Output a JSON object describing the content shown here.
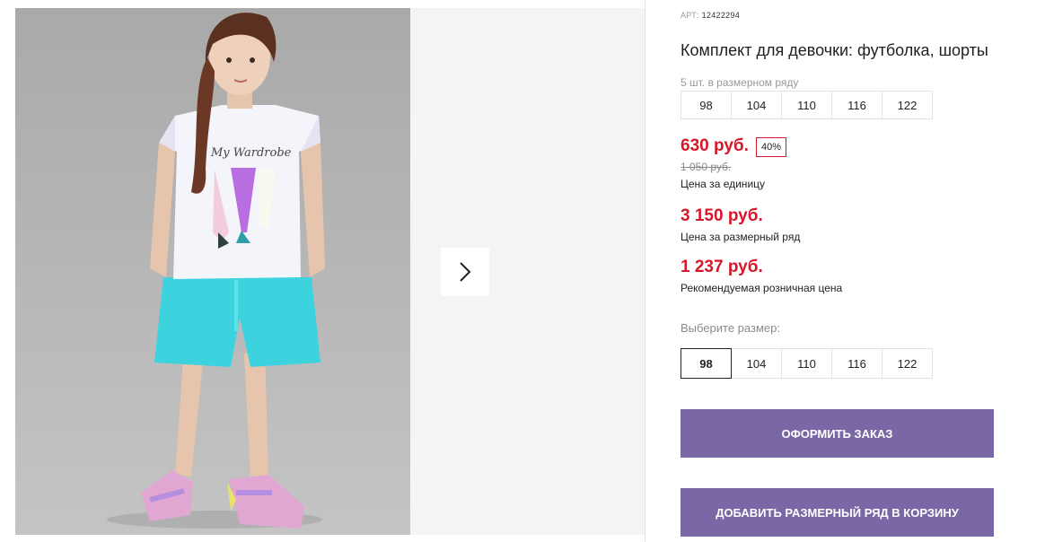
{
  "product": {
    "art_label": "АРТ:",
    "art_number": "12422294",
    "title": "Комплект для девочки: футболка, шорты",
    "pack_info": "5 шт. в размерном ряду",
    "pack_sizes": [
      "98",
      "104",
      "110",
      "116",
      "122"
    ]
  },
  "pricing": {
    "unit_price": "630 руб.",
    "discount": "40%",
    "old_price": "1 050 руб.",
    "unit_price_label": "Цена за единицу",
    "row_price": "3 150 руб.",
    "row_price_label": "Цена за размерный ряд",
    "retail_price": "1 237 руб.",
    "retail_price_label": "Рекомендуемая розничная цена",
    "accent_color": "#d6172a"
  },
  "size_picker": {
    "label": "Выберите размер:",
    "options": [
      "98",
      "104",
      "110",
      "116",
      "122"
    ],
    "selected": "98"
  },
  "actions": {
    "order_label": "ОФОРМИТЬ ЗАКАЗ",
    "add_row_label": "ДОБАВИТЬ РАЗМЕРНЫЙ РЯД В КОРЗИНУ",
    "button_color": "#7a68a6"
  },
  "gallery": {
    "shirt_print_text": "My Wardrobe",
    "next_icon": "chevron-right-icon"
  }
}
